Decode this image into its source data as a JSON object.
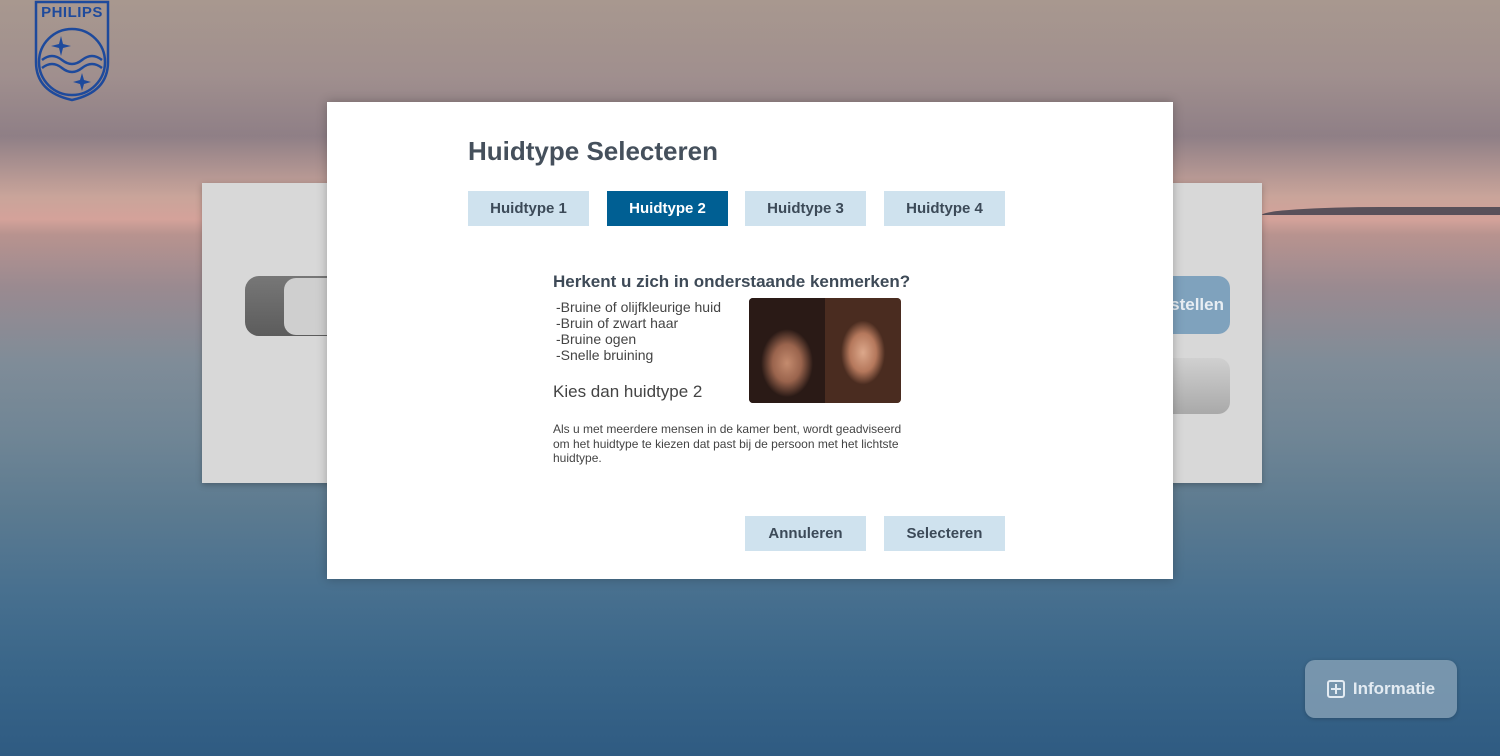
{
  "brand": {
    "logo_text": "PHILIPS"
  },
  "background": {
    "button_partial_label": "stellen"
  },
  "dialog": {
    "title": "Huidtype Selecteren",
    "tabs": [
      {
        "label": "Huidtype 1",
        "active": false
      },
      {
        "label": "Huidtype 2",
        "active": true
      },
      {
        "label": "Huidtype 3",
        "active": false
      },
      {
        "label": "Huidtype 4",
        "active": false
      }
    ],
    "question": "Herkent u zich in onderstaande kenmerken?",
    "traits": [
      "-Bruine of olijfkleurige huid",
      "-Bruin of zwart haar",
      "-Bruine ogen",
      "-Snelle bruining"
    ],
    "advice": "Kies dan huidtype 2",
    "note": "Als u met meerdere mensen in de kamer bent, wordt geadviseerd om het huidtype te kiezen dat past bij de persoon met het lichtste huidtype.",
    "cancel_label": "Annuleren",
    "select_label": "Selecteren"
  },
  "info_button": {
    "label": "Informatie",
    "icon": "plus-square-icon"
  },
  "colors": {
    "accent": "#005f93",
    "tab_inactive": "#cfe2ee",
    "title_text": "#45505c",
    "logo_blue": "#1e4a9c"
  }
}
